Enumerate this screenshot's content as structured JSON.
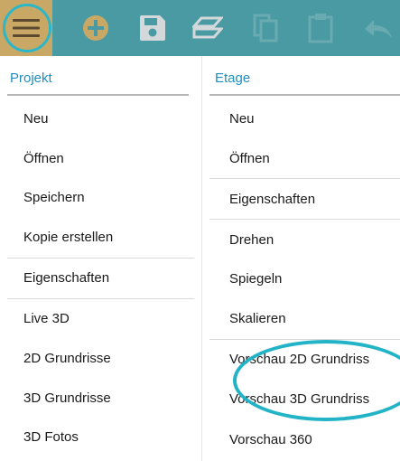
{
  "toolbar": {
    "buttons": [
      {
        "icon": "hamburger-menu-icon",
        "color": "#5b4a2e",
        "background": "#c9a865"
      },
      {
        "icon": "add-circle-icon",
        "color": "#c9a865"
      },
      {
        "icon": "save-icon",
        "color": "#d3d8da"
      },
      {
        "icon": "layers-icon",
        "color": "#d3d8da"
      },
      {
        "icon": "copy-icon",
        "color": "#6aaab1"
      },
      {
        "icon": "paste-icon",
        "color": "#6aaab1"
      },
      {
        "icon": "undo-icon",
        "color": "#6aaab1"
      }
    ],
    "background": "#4a9aa3"
  },
  "left_panel": {
    "header": "Projekt",
    "items": [
      "Neu",
      "Öffnen",
      "Speichern",
      "Kopie erstellen",
      "Eigenschaften",
      "Live 3D",
      "2D Grundrisse",
      "3D Grundrisse",
      "3D Fotos"
    ]
  },
  "right_panel": {
    "header": "Etage",
    "items": [
      "Neu",
      "Öffnen",
      "Eigenschaften",
      "Drehen",
      "Spiegeln",
      "Skalieren",
      "Vorschau 2D Grundriss",
      "Vorschau 3D Grundriss",
      "Vorschau 360"
    ]
  },
  "colors": {
    "accent_ring": "#22b4c6",
    "header_text": "#1f8fbf"
  }
}
